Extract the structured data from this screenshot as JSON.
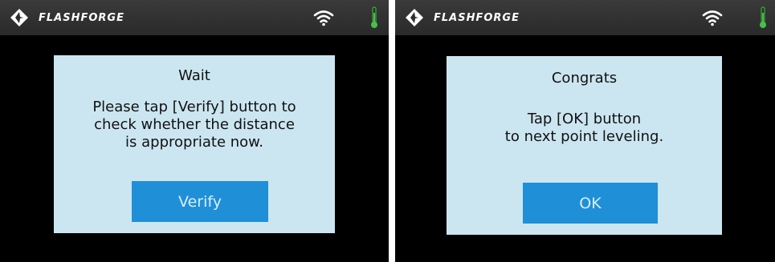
{
  "screens": [
    {
      "brand": "FLASHFORGE",
      "dialog": {
        "title": "Wait",
        "message_lines": [
          "Please tap [Verify] button to",
          "check whether the distance",
          "is appropriate now."
        ],
        "button_label": "Verify"
      }
    },
    {
      "brand": "FLASHFORGE",
      "dialog": {
        "title": "Congrats",
        "message_lines": [
          "Tap [OK] button",
          "to next point leveling."
        ],
        "button_label": "OK"
      }
    }
  ],
  "colors": {
    "dialog_background": "#cce6f1",
    "button": "#1f8fd7",
    "button_text": "#d8eefc",
    "thermometer": "#48c048",
    "status_bar": "#2a2a2a"
  },
  "icons": {
    "logo": "flashforge-logo-icon",
    "wifi": "wifi-icon",
    "thermometer": "thermometer-icon"
  }
}
